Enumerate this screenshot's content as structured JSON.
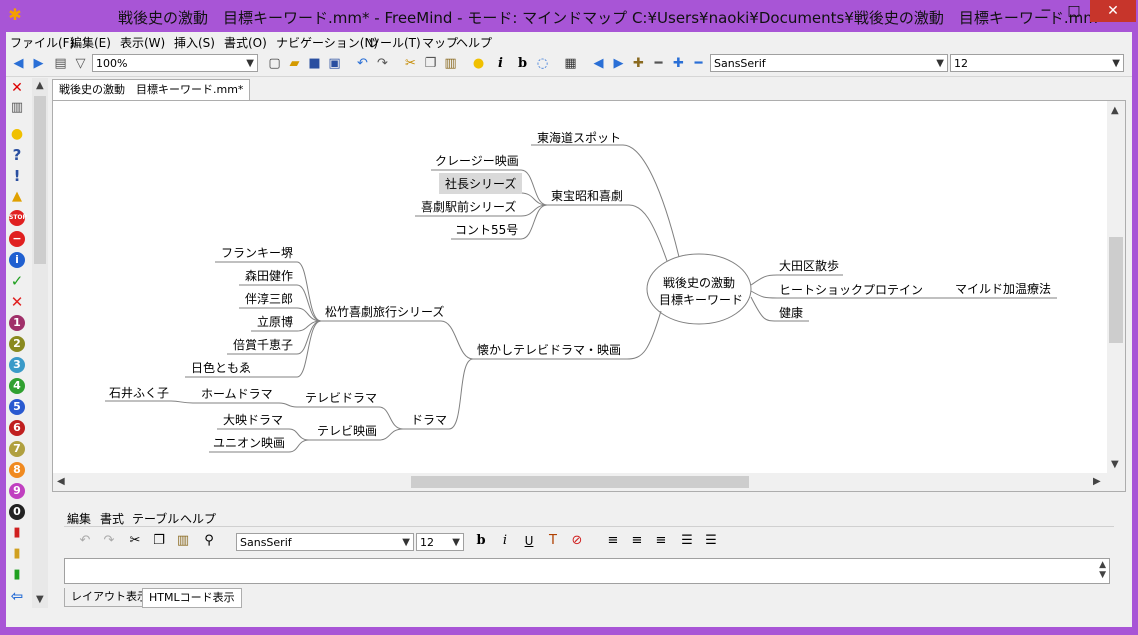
{
  "window": {
    "title": "戦後史の激動　目標キーワード.mm* - FreeMind - モード: マインドマップ C:¥Users¥naoki¥Documents¥戦後史の激動　目標キーワード.mm",
    "app_icon": "butterfly-icon",
    "min_glyph": "─",
    "max_glyph": "□",
    "close_glyph": "✕"
  },
  "menubar": [
    "ファイル(F)",
    "編集(E)",
    "表示(W)",
    "挿入(S)",
    "書式(O)",
    "ナビゲーション(N)",
    "ツール(T)",
    "マップ",
    "ヘルプ"
  ],
  "toolbar": {
    "zoom": "100%",
    "font_family": "SansSerif",
    "font_size": "12",
    "italic_glyph": "i",
    "bold_glyph": "b",
    "icons": [
      "back-icon",
      "forward-icon",
      "print-icon",
      "filter-icon",
      "new-icon",
      "open-icon",
      "save-icon",
      "save-as-icon",
      "undo-icon",
      "redo-icon",
      "cut-icon",
      "copy-icon",
      "paste-icon",
      "idea-icon",
      "italic-icon",
      "bold-icon",
      "note-icon",
      "table-icon",
      "left-icon",
      "right-icon",
      "add-icon",
      "remove-icon",
      "plus-icon",
      "minus-icon"
    ]
  },
  "doc_tab": "戦後史の激動　目標キーワード.mm*",
  "mindmap": {
    "root_line1": "戦後史の激動",
    "root_line2": "目標キーワード",
    "n_tokaido": "東海道スポット",
    "n_toho": "東宝昭和喜劇",
    "n_crazy": "クレージー映画",
    "n_shacho": "社長シリーズ",
    "n_ekimae": "喜劇駅前シリーズ",
    "n_conte": "コント55号",
    "n_ota": "大田区散歩",
    "n_heatshock": "ヒートショックプロテイン",
    "n_mild": "マイルド加温療法",
    "n_kenko": "健康",
    "n_natsukashi": "懐かしテレビドラマ・映画",
    "n_shochiku": "松竹喜劇旅行シリーズ",
    "n_frankie": "フランキー堺",
    "n_morita": "森田健作",
    "n_ban": "伴淳三郎",
    "n_tachihara": "立原博",
    "n_baisho": "倍賞千恵子",
    "n_hiiro": "日色ともゑ",
    "n_drama": "ドラマ",
    "n_tvdrama": "テレビドラマ",
    "n_homedrama": "ホームドラマ",
    "n_ishii": "石井ふく子",
    "n_tveiga": "テレビ映画",
    "n_daiei": "大映ドラマ",
    "n_union": "ユニオン映画"
  },
  "editor": {
    "menus": [
      "編集",
      "書式",
      "テーブル",
      "ヘルプ"
    ],
    "font_family": "SansSerif",
    "font_size": "12",
    "tab_layout": "レイアウト表示",
    "tab_html": "HTMLコード表示",
    "bold_glyph": "b",
    "italic_glyph": "i",
    "underline_glyph": "U"
  },
  "iconbar": [
    "close-icon",
    "trash-icon",
    "idea-icon",
    "question-icon",
    "exclamation-icon",
    "warning-icon",
    "stop-icon",
    "no-entry-icon",
    "info-icon",
    "check-icon",
    "cross-icon",
    "priority-1-icon",
    "priority-2-icon",
    "priority-3-icon",
    "priority-4-icon",
    "priority-5-icon",
    "priority-6-icon",
    "priority-7-icon",
    "priority-8-icon",
    "priority-9-icon",
    "priority-0-icon",
    "traffic-light-red-icon",
    "traffic-light-yellow-icon",
    "traffic-light-green-icon",
    "back-arrow-icon"
  ],
  "priority_digits": [
    "1",
    "2",
    "3",
    "4",
    "5",
    "6",
    "7",
    "8",
    "9",
    "0"
  ],
  "colors": {
    "window_frame": "#a855d6",
    "close_button": "#c7352b",
    "selected_node_bg": "#d9d9d9",
    "edge": "#808080"
  }
}
